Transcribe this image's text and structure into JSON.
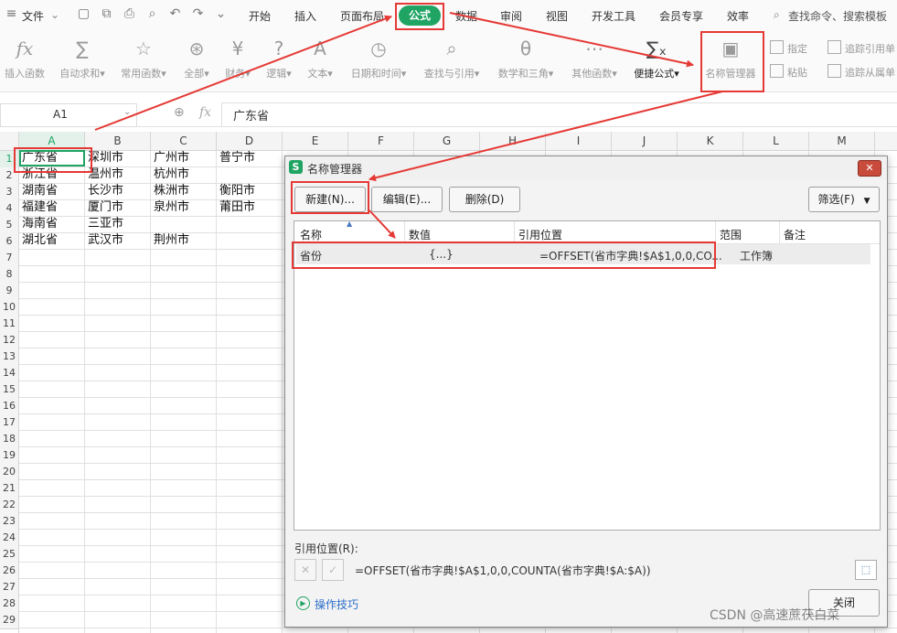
{
  "menubar": {
    "file": "文件",
    "tabs": [
      "开始",
      "插入",
      "页面布局",
      "公式",
      "数据",
      "审阅",
      "视图",
      "开发工具",
      "会员专享",
      "效率"
    ],
    "search": "查找命令、搜索模板",
    "active_tab": "公式"
  },
  "ribbon": {
    "insert_function": "插入函数",
    "autosum": "自动求和",
    "common_func": "常用函数",
    "all": "全部",
    "finance": "财务",
    "logic": "逻辑",
    "text": "文本",
    "datetime": "日期和时间",
    "lookup": "查找与引用",
    "math": "数学和三角",
    "other_func": "其他函数",
    "quick_formula": "便捷公式",
    "name_manager": "名称管理器",
    "specify": "指定",
    "paste": "粘贴",
    "trace_precedents": "追踪引用单",
    "trace_dependents": "追踪从属单"
  },
  "formula_bar": {
    "cell_ref": "A1",
    "fx": "fx",
    "content": "广东省"
  },
  "sheet": {
    "columns": [
      "A",
      "B",
      "C",
      "D",
      "E",
      "F",
      "G",
      "H",
      "I",
      "J",
      "K",
      "L",
      "M"
    ],
    "rows": [
      "1",
      "2",
      "3",
      "4",
      "5",
      "6",
      "7",
      "8",
      "9",
      "10",
      "11",
      "12",
      "13",
      "14",
      "15",
      "16",
      "17",
      "18",
      "19",
      "20",
      "21",
      "22",
      "23",
      "24",
      "25",
      "26",
      "27",
      "28",
      "29"
    ],
    "data": [
      [
        "广东省",
        "深圳市",
        "广州市",
        "普宁市"
      ],
      [
        "浙江省",
        "温州市",
        "杭州市",
        ""
      ],
      [
        "湖南省",
        "长沙市",
        "株洲市",
        "衡阳市"
      ],
      [
        "福建省",
        "厦门市",
        "泉州市",
        "莆田市"
      ],
      [
        "海南省",
        "三亚市",
        "",
        ""
      ],
      [
        "湖北省",
        "武汉市",
        "荆州市",
        ""
      ]
    ]
  },
  "dialog": {
    "title": "名称管理器",
    "new_btn": "新建(N)...",
    "edit_btn": "编辑(E)...",
    "delete_btn": "删除(D)",
    "filter_btn": "筛选(F)",
    "headers": [
      "名称",
      "数值",
      "引用位置",
      "范围",
      "备注"
    ],
    "rows": [
      {
        "name": "省份",
        "value": "{...}",
        "ref": "=OFFSET(省市字典!$A$1,0,0,CO...",
        "scope": "工作簿",
        "note": ""
      }
    ],
    "ref_label": "引用位置(R):",
    "ref_value": "=OFFSET(省市字典!$A$1,0,0,COUNTA(省市字典!$A:$A))",
    "tips": "操作技巧",
    "close_btn": "关闭"
  },
  "watermark": "CSDN @高速蔗茯白菜",
  "colors": {
    "accent": "#1fa463",
    "annotation": "#e53935"
  }
}
